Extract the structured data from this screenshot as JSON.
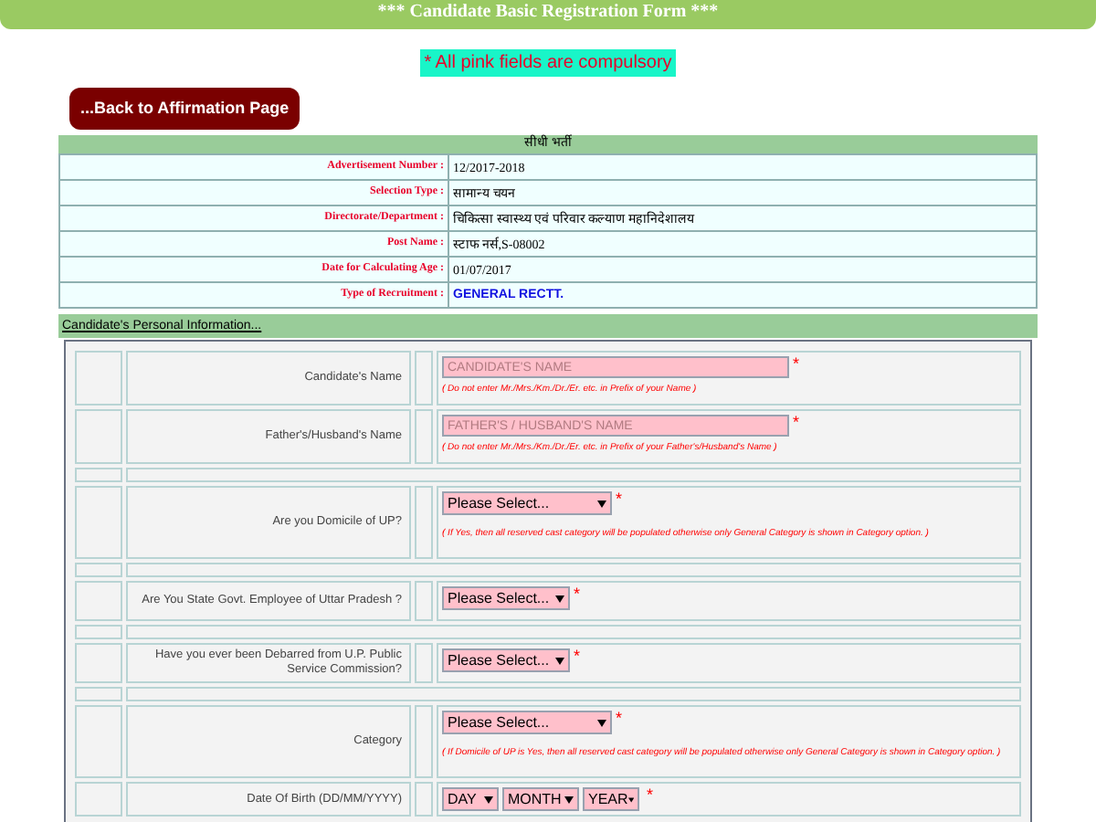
{
  "title": "*** Candidate Basic Registration Form ***",
  "notice": "* All pink fields are compulsory",
  "back_button": "...Back to Affirmation Page",
  "details": {
    "heading": "सीधी भर्ती",
    "rows": [
      {
        "label": "Advertisement Number :",
        "value": "12/2017-2018",
        "kind": "plain"
      },
      {
        "label": "Selection Type :",
        "value": "सामान्य चयन",
        "kind": "plain"
      },
      {
        "label": "Directorate/Department :",
        "value": "चिकित्सा स्वास्थ्य एवं परिवार कल्याण महानिदेशालय",
        "kind": "plain"
      },
      {
        "label": "Post Name :",
        "value": "स्टाफ नर्स,S-08002",
        "kind": "plain"
      },
      {
        "label": "Date for Calculating Age :",
        "value": "01/07/2017",
        "kind": "plain"
      },
      {
        "label": "Type of Recruitment :",
        "value": "GENERAL RECTT.",
        "kind": "highlight"
      }
    ]
  },
  "personal": {
    "heading": "Candidate's Personal Information...",
    "rows": [
      {
        "kind": "input",
        "label": "Candidate's Name",
        "placeholder": "CANDIDATE'S NAME",
        "mark": "*",
        "hint": "( Do not enter Mr./Mrs./Km./Dr./Er. etc. in Prefix of your Name )"
      },
      {
        "kind": "input",
        "label": "Father's/Husband's Name",
        "placeholder": "FATHER'S / HUSBAND'S NAME",
        "mark": "*",
        "hint": "( Do not enter Mr./Mrs./Km./Dr./Er. etc. in Prefix of your Father's/Husband's Name )"
      },
      {
        "kind": "spacer"
      },
      {
        "kind": "select",
        "wide": true,
        "label": "Are you Domicile of UP?",
        "value": "Please Select...",
        "mark": "*",
        "hint": "( If Yes, then all reserved cast category will be populated otherwise only General Category is shown in Category option. )"
      },
      {
        "kind": "spacer"
      },
      {
        "kind": "select",
        "wide": false,
        "label": "Are You State Govt. Employee of Uttar Pradesh ?",
        "value": "Please Select...",
        "mark": "*"
      },
      {
        "kind": "spacer"
      },
      {
        "kind": "select",
        "wide": false,
        "label": "Have you ever been Debarred from U.P. Public Service Commission?",
        "value": "Please Select...",
        "mark": "*"
      },
      {
        "kind": "spacer"
      },
      {
        "kind": "select",
        "wide": true,
        "label": "Category",
        "value": "Please Select...",
        "mark": "*",
        "hint": "( If Domicile of UP is Yes, then all reserved cast category will be populated otherwise only General Category is shown in Category option. )"
      },
      {
        "kind": "date",
        "label": "Date Of Birth (DD/MM/YYYY)",
        "parts": [
          "DAY",
          "MONTH",
          "YEAR"
        ],
        "mark": "*"
      }
    ]
  }
}
